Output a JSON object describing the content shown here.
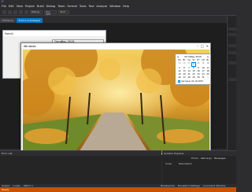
{
  "ide": {
    "menu": [
      "File",
      "Edit",
      "View",
      "Project",
      "Build",
      "Debug",
      "Team",
      "Format",
      "Tools",
      "Test",
      "Analyze",
      "Window",
      "Help"
    ],
    "toolbar_combo_1": "Debug",
    "toolbar_combo_2": "Any CPU",
    "toolbar_start": "Start",
    "doc_tabs": [
      "Form1.cs",
      "Form1.cs [Design]"
    ],
    "accent": "#007acc",
    "status_color": "#ca5100"
  },
  "form_window": {
    "title": "Form1",
    "combo_value": "Октябрь 2015"
  },
  "picture_window": {
    "title": "Windows",
    "controls": [
      "–",
      "□",
      "✕"
    ]
  },
  "calendar": {
    "month": "Октябрь 2015",
    "weekdays": [
      "Пн",
      "Вт",
      "Ср",
      "Чт",
      "Пт",
      "Сб",
      "Вс"
    ],
    "days": [
      "28",
      "29",
      "30",
      "1",
      "2",
      "3",
      "4",
      "5",
      "6",
      "7",
      "8",
      "9",
      "10",
      "11",
      "12",
      "13",
      "14",
      "15",
      "16",
      "17",
      "18",
      "19",
      "20",
      "21",
      "22",
      "23",
      "24",
      "25",
      "26",
      "27",
      "28",
      "29",
      "30",
      "31",
      "1"
    ],
    "selected_day": "1",
    "today": "Сегодня: 01.10.2015"
  },
  "bottom_left": {
    "header": "Error List"
  },
  "bottom_right": {
    "header": "Solution Explorer",
    "tabs": [
      "Errors",
      "Warnings",
      "Messages"
    ],
    "columns": [
      "Code",
      "Description"
    ]
  },
  "bottom_tabs": [
    "Output",
    "Locals",
    "Watch 1"
  ],
  "bottom_tabs_right": [
    "Breakpoints",
    "Exception Settings",
    "Command Window"
  ],
  "status": "Ready"
}
